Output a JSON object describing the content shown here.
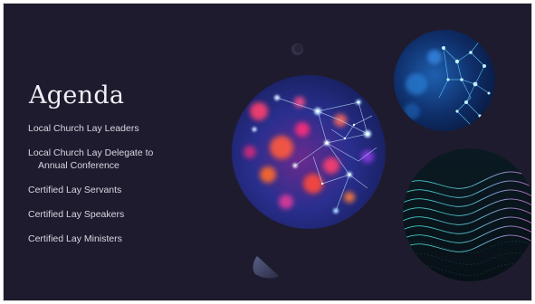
{
  "slide": {
    "title": "Agenda",
    "items": [
      {
        "line1": "Local Church Lay Leaders",
        "line2": ""
      },
      {
        "line1": "Local Church Lay Delegate to",
        "line2": "Annual Conference"
      },
      {
        "line1": "Certified Lay Servants",
        "line2": ""
      },
      {
        "line1": "Certified Lay Speakers",
        "line2": ""
      },
      {
        "line1": "Certified Lay Ministers",
        "line2": ""
      }
    ]
  },
  "colors": {
    "background": "#1f1b2e",
    "title": "#f1eff6",
    "body_text": "#d9d6e2",
    "accent_red": "#ff3f6e",
    "accent_blue": "#4aa8ff",
    "accent_teal": "#42e3d6"
  },
  "decorations": [
    {
      "name": "network-bokeh-image",
      "kind": "photo"
    },
    {
      "name": "blue-network-image",
      "kind": "photo"
    },
    {
      "name": "data-wave-image",
      "kind": "photo"
    },
    {
      "name": "ring-shape",
      "kind": "shape"
    },
    {
      "name": "cone-shape",
      "kind": "shape"
    }
  ]
}
